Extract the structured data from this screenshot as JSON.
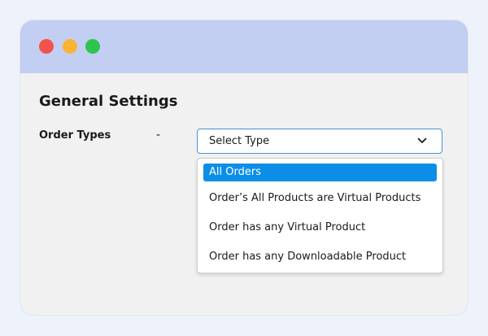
{
  "window": {
    "controls": [
      "close",
      "minimize",
      "maximize"
    ]
  },
  "page": {
    "title": "General Settings"
  },
  "field": {
    "label": "Order Types",
    "separator": "-",
    "select_value": "Select Type",
    "select_icon": "chevron-down-icon"
  },
  "dropdown": {
    "options": [
      {
        "label": "All Orders",
        "selected": true
      },
      {
        "label": "Order’s All Products are Virtual Products",
        "selected": false
      },
      {
        "label": "Order has any Virtual Product",
        "selected": false
      },
      {
        "label": "Order has any Downloadable Product",
        "selected": false
      }
    ]
  },
  "colors": {
    "titlebar": "#c3cff2",
    "close": "#f2524c",
    "minimize": "#f8b535",
    "maximize": "#2fc44f",
    "selection": "#0c8ee8",
    "select_border": "#4d8fd6"
  }
}
